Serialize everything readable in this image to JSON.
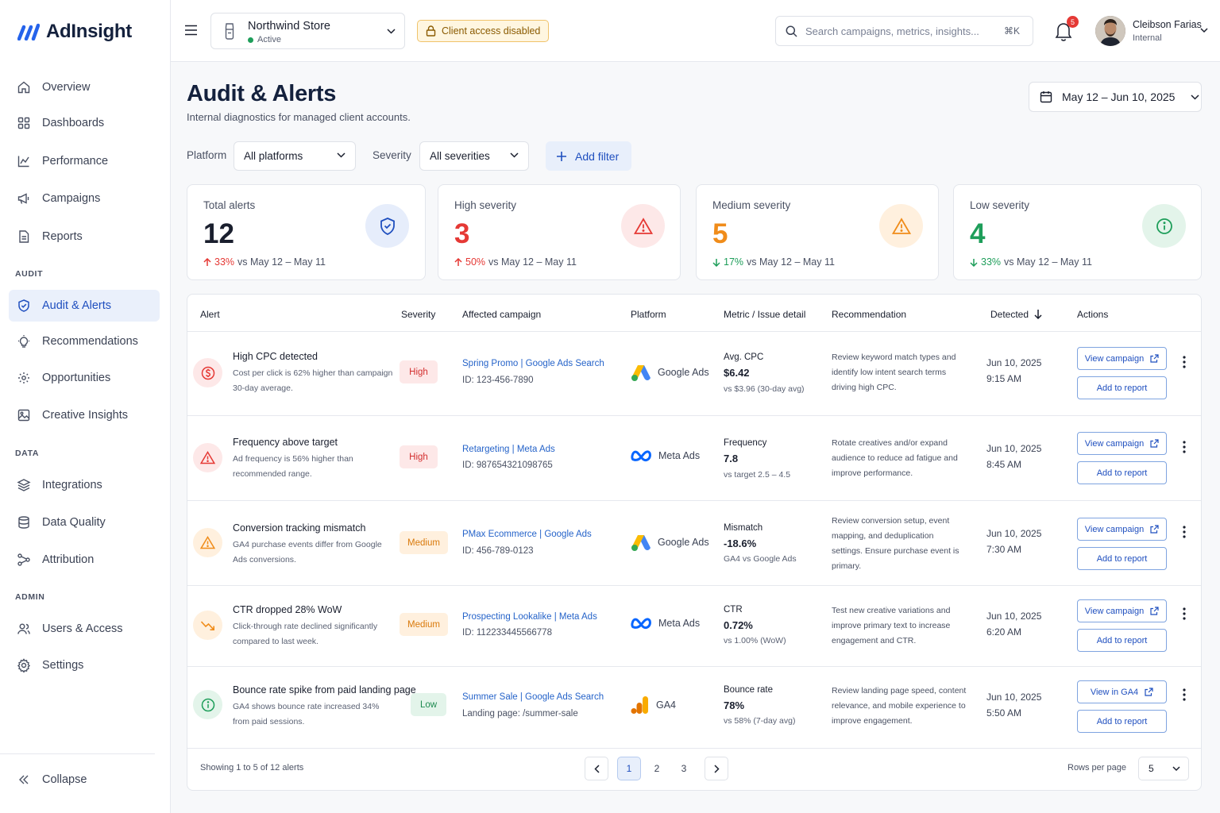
{
  "app": {
    "name": "AdInsight"
  },
  "sidebar": {
    "main_items": [
      {
        "label": "Overview",
        "icon": "home-icon"
      },
      {
        "label": "Dashboards",
        "icon": "grid-icon"
      },
      {
        "label": "Performance",
        "icon": "chart-icon"
      },
      {
        "label": "Campaigns",
        "icon": "megaphone-icon"
      },
      {
        "label": "Reports",
        "icon": "document-icon"
      }
    ],
    "audit_section": "AUDIT",
    "audit_items": [
      {
        "label": "Audit & Alerts",
        "icon": "shield-icon",
        "active": true
      },
      {
        "label": "Recommendations",
        "icon": "lightbulb-icon"
      },
      {
        "label": "Opportunities",
        "icon": "sparkle-icon"
      },
      {
        "label": "Creative Insights",
        "icon": "image-icon"
      }
    ],
    "data_section": "DATA",
    "data_items": [
      {
        "label": "Integrations",
        "icon": "layers-icon"
      },
      {
        "label": "Data Quality",
        "icon": "database-icon"
      },
      {
        "label": "Attribution",
        "icon": "nodes-icon"
      }
    ],
    "admin_section": "ADMIN",
    "admin_items": [
      {
        "label": "Users & Access",
        "icon": "users-icon"
      },
      {
        "label": "Settings",
        "icon": "gear-icon"
      }
    ],
    "collapse_label": "Collapse"
  },
  "topbar": {
    "store_name": "Northwind Store",
    "store_status": "Active",
    "client_access": "Client access disabled",
    "search_placeholder": "Search campaigns, metrics, insights...",
    "search_shortcut": "⌘K",
    "notification_count": "5",
    "user_name": "Cleibson Farias",
    "user_role": "Internal"
  },
  "page": {
    "title": "Audit & Alerts",
    "subtitle": "Internal diagnostics for managed client accounts.",
    "date_range": "May 12 – Jun 10, 2025"
  },
  "filters": {
    "platform_label": "Platform",
    "platform_value": "All platforms",
    "severity_label": "Severity",
    "severity_value": "All severities",
    "add_filter": "Add filter"
  },
  "summary_cards": [
    {
      "label": "Total alerts",
      "value": "12",
      "delta": "33%",
      "compare": "vs May 12 – May 11",
      "direction": "up",
      "color": "#1a1f2e",
      "delta_color": "#e53935"
    },
    {
      "label": "High severity",
      "value": "3",
      "delta": "50%",
      "compare": "vs May 12 – May 11",
      "direction": "up",
      "color": "#e53935",
      "delta_color": "#e53935"
    },
    {
      "label": "Medium severity",
      "value": "5",
      "delta": "17%",
      "compare": "vs May 12 – May 11",
      "direction": "down",
      "color": "#f08c1a",
      "delta_color": "#1e9e5a"
    },
    {
      "label": "Low severity",
      "value": "4",
      "delta": "33%",
      "compare": "vs May 12 – May 11",
      "direction": "down",
      "color": "#1e9e5a",
      "delta_color": "#1e9e5a"
    }
  ],
  "table": {
    "headers": {
      "alert": "Alert",
      "severity": "Severity",
      "campaign": "Affected campaign",
      "platform": "Platform",
      "metric": "Metric / Issue detail",
      "recommendation": "Recommendation",
      "detected": "Detected",
      "actions": "Actions"
    },
    "rows": [
      {
        "title": "High CPC detected",
        "desc": "Cost per click is 62% higher than campaign 30-day average.",
        "severity": "High",
        "campaign": "Spring Promo | Google Ads Search",
        "campaign_id": "ID: 123-456-7890",
        "platform": "Google Ads",
        "metric_label": "Avg. CPC",
        "metric_value": "$6.42",
        "metric_sub": "vs $3.96 (30-day avg)",
        "recommendation": "Review keyword match types and identify low intent search terms driving high CPC.",
        "date": "Jun 10, 2025",
        "time": "9:15 AM",
        "primary_action": "View campaign",
        "secondary_action": "Add to report"
      },
      {
        "title": "Frequency above target",
        "desc": "Ad frequency is 56% higher than recommended range.",
        "severity": "High",
        "campaign": "Retargeting | Meta Ads",
        "campaign_id": "ID: 987654321098765",
        "platform": "Meta Ads",
        "metric_label": "Frequency",
        "metric_value": "7.8",
        "metric_sub": "vs target 2.5 – 4.5",
        "recommendation": "Rotate creatives and/or expand audience to reduce ad fatigue and improve performance.",
        "date": "Jun 10, 2025",
        "time": "8:45 AM",
        "primary_action": "View campaign",
        "secondary_action": "Add to report"
      },
      {
        "title": "Conversion tracking mismatch",
        "desc": "GA4 purchase events differ from Google Ads conversions.",
        "severity": "Medium",
        "campaign": "PMax Ecommerce | Google Ads",
        "campaign_id": "ID: 456-789-0123",
        "platform": "Google Ads",
        "metric_label": "Mismatch",
        "metric_value": "-18.6%",
        "metric_sub": "GA4 vs Google Ads",
        "recommendation": "Review conversion setup, event mapping, and deduplication settings. Ensure purchase event is primary.",
        "date": "Jun 10, 2025",
        "time": "7:30 AM",
        "primary_action": "View campaign",
        "secondary_action": "Add to report"
      },
      {
        "title": "CTR dropped 28% WoW",
        "desc": "Click-through rate declined significantly compared to last week.",
        "severity": "Medium",
        "campaign": "Prospecting Lookalike | Meta Ads",
        "campaign_id": "ID: 112233445566778",
        "platform": "Meta Ads",
        "metric_label": "CTR",
        "metric_value": "0.72%",
        "metric_sub": "vs 1.00% (WoW)",
        "recommendation": "Test new creative variations and improve primary text to increase engagement and CTR.",
        "date": "Jun 10, 2025",
        "time": "6:20 AM",
        "primary_action": "View campaign",
        "secondary_action": "Add to report"
      },
      {
        "title": "Bounce rate spike from paid landing page",
        "desc": "GA4 shows bounce rate increased 34% from paid sessions.",
        "severity": "Low",
        "campaign": "Summer Sale | Google Ads Search",
        "campaign_id": "Landing page: /summer-sale",
        "platform": "GA4",
        "metric_label": "Bounce rate",
        "metric_value": "78%",
        "metric_sub": "vs 58% (7-day avg)",
        "recommendation": "Review landing page speed, content relevance, and mobile experience to improve engagement.",
        "date": "Jun 10, 2025",
        "time": "5:50 AM",
        "primary_action": "View in GA4",
        "secondary_action": "Add to report"
      }
    ],
    "footer_text": "Showing 1 to 5 of 12 alerts",
    "pages": [
      "1",
      "2",
      "3"
    ],
    "rows_per_page_label": "Rows per page",
    "rows_per_page": "5"
  },
  "colors": {
    "accent": "#1f4fbf",
    "high": "#e53935",
    "medium": "#f08c1a",
    "low": "#1e9e5a"
  }
}
